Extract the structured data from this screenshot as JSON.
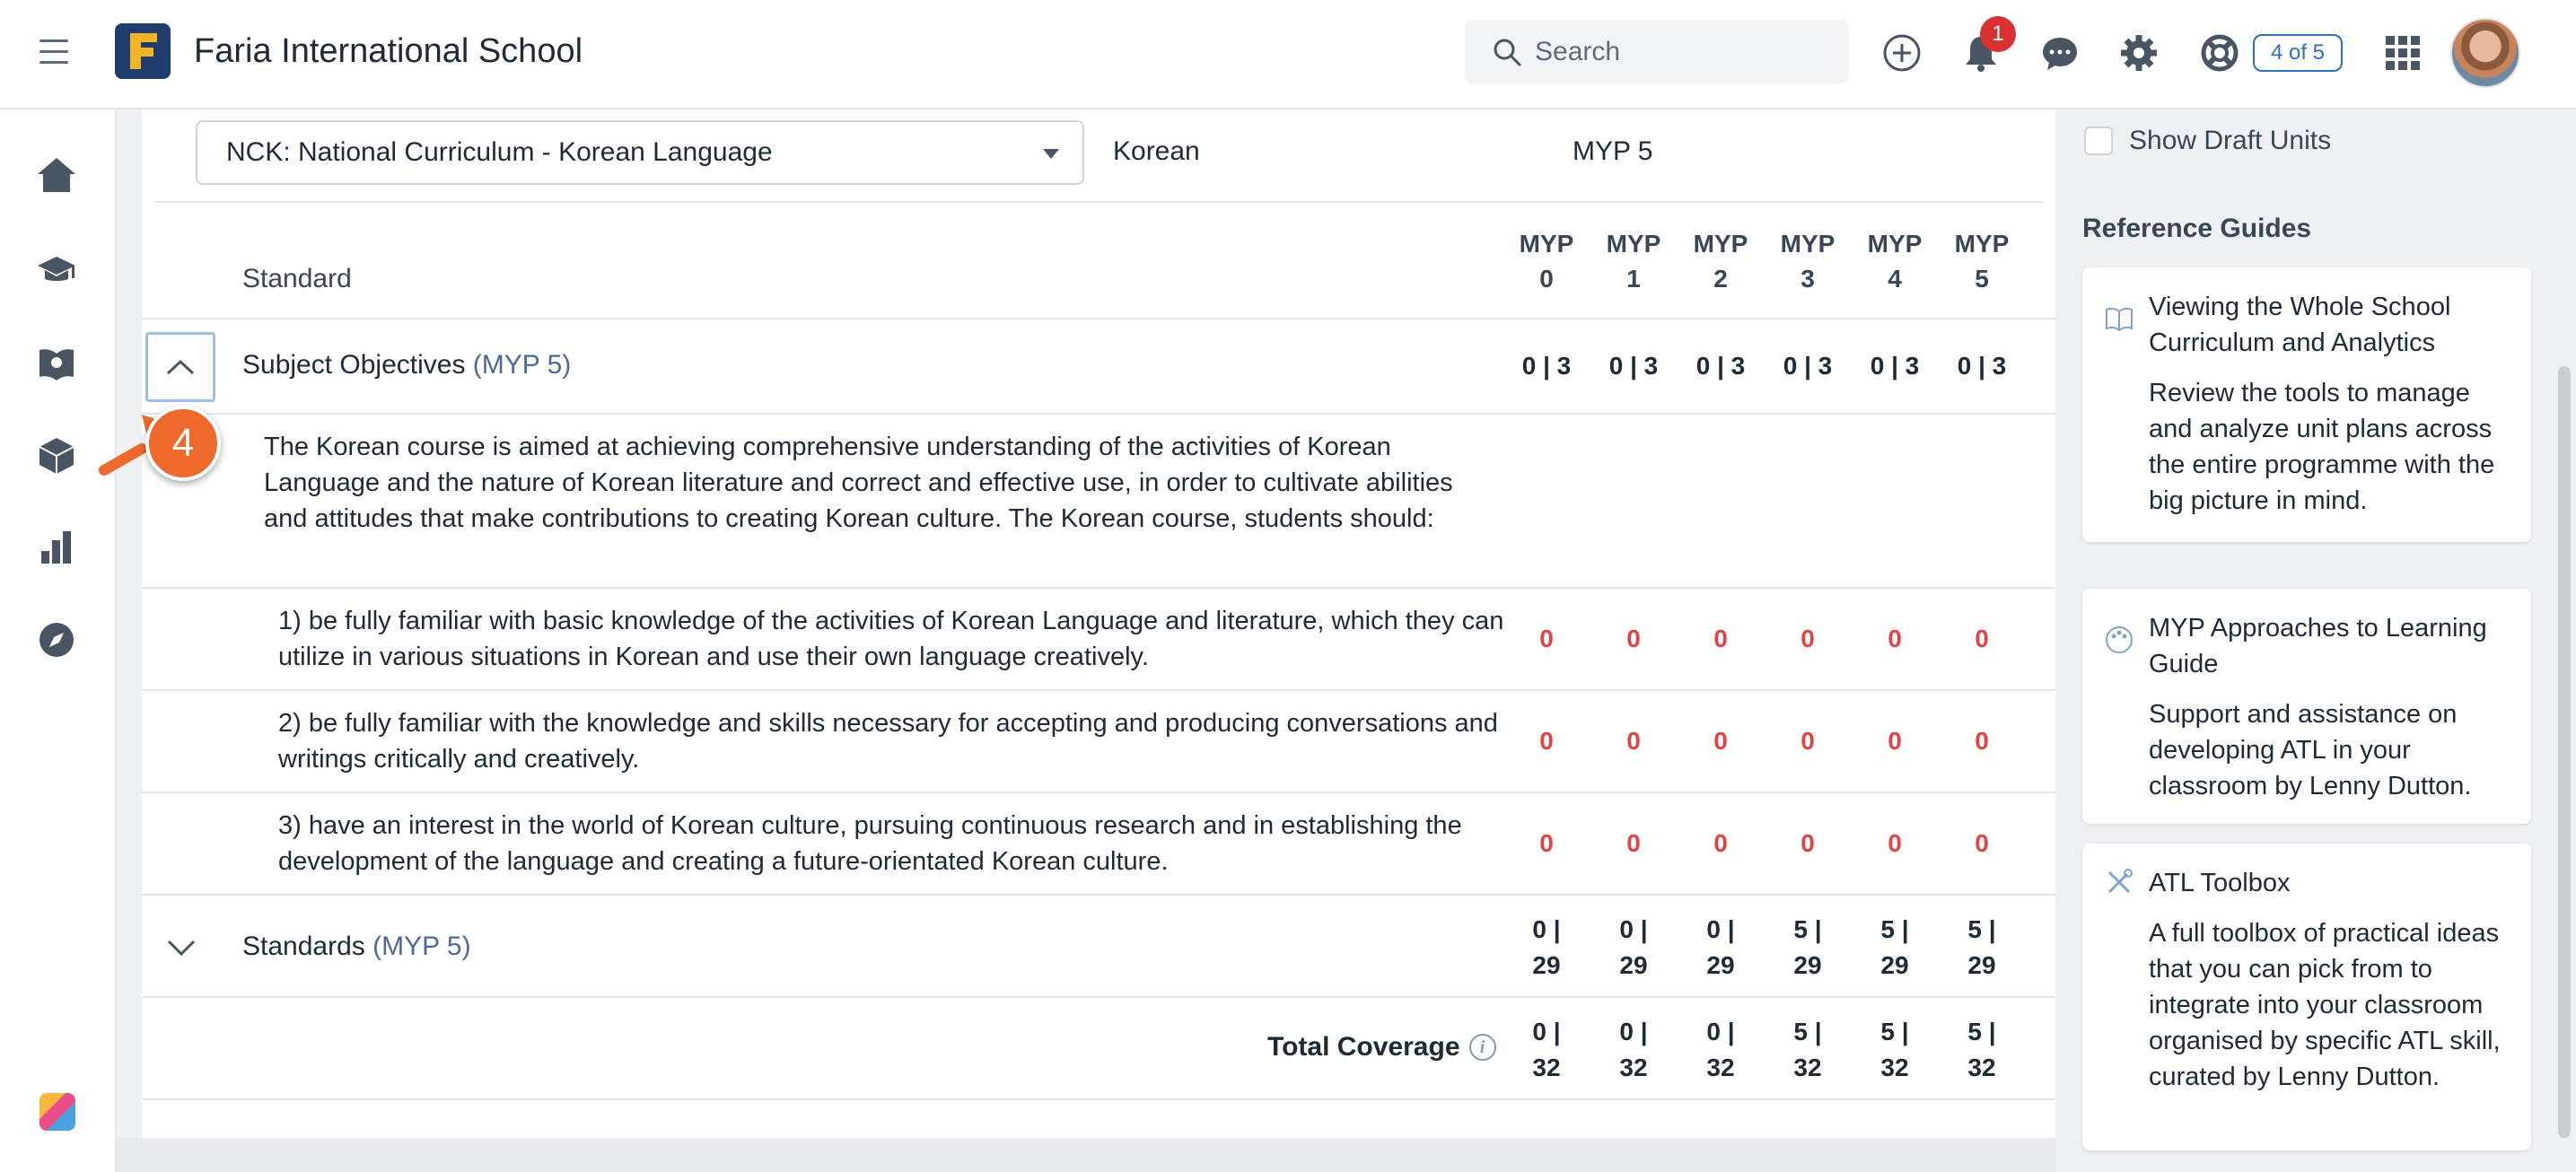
{
  "header": {
    "school_name": "Faria International School",
    "search_placeholder": "Search",
    "notification_count": "1",
    "page_indicator": "4 of 5"
  },
  "filters": {
    "curriculum": "NCK: National Curriculum - Korean Language",
    "subject": "Korean",
    "grade": "MYP 5"
  },
  "table": {
    "standard_header": "Standard",
    "columns": [
      {
        "line1": "MYP",
        "line2": "0"
      },
      {
        "line1": "MYP",
        "line2": "1"
      },
      {
        "line1": "MYP",
        "line2": "2"
      },
      {
        "line1": "MYP",
        "line2": "3"
      },
      {
        "line1": "MYP",
        "line2": "4"
      },
      {
        "line1": "MYP",
        "line2": "5"
      }
    ],
    "subject_objectives": {
      "title": "Subject Objectives",
      "grade": "(MYP 5)",
      "values": [
        "0 | 3",
        "0 | 3",
        "0 | 3",
        "0 | 3",
        "0 | 3",
        "0 | 3"
      ],
      "description": "The Korean course is aimed at achieving comprehensive understanding of the activities of Korean Language and the nature of Korean literature and correct and effective use, in order to cultivate abilities and attitudes that make contributions to creating Korean culture. The Korean course, students should:",
      "objectives": [
        {
          "text": "1) be fully familiar with basic knowledge of the activities of Korean Language and literature, which they can utilize in various situations in Korean and use their own language creatively.",
          "values": [
            "0",
            "0",
            "0",
            "0",
            "0",
            "0"
          ]
        },
        {
          "text": "2) be fully familiar with the knowledge and skills necessary for accepting and producing conversations and writings critically and creatively.",
          "values": [
            "0",
            "0",
            "0",
            "0",
            "0",
            "0"
          ]
        },
        {
          "text": "3) have an interest in the world of Korean culture, pursuing continuous research and in establishing the development of the language and creating a future-orientated Korean culture.",
          "values": [
            "0",
            "0",
            "0",
            "0",
            "0",
            "0"
          ]
        }
      ]
    },
    "standards": {
      "title": "Standards",
      "grade": "(MYP 5)",
      "values": [
        {
          "top": "0 |",
          "bottom": "29"
        },
        {
          "top": "0 |",
          "bottom": "29"
        },
        {
          "top": "0 |",
          "bottom": "29"
        },
        {
          "top": "5 |",
          "bottom": "29"
        },
        {
          "top": "5 |",
          "bottom": "29"
        },
        {
          "top": "5 |",
          "bottom": "29"
        }
      ]
    },
    "total_coverage": {
      "label": "Total Coverage",
      "info_glyph": "i",
      "values": [
        {
          "top": "0",
          "bottom": "32",
          "top_color": "red"
        },
        {
          "top": "0",
          "bottom": "32",
          "top_color": "red"
        },
        {
          "top": "0",
          "bottom": "32",
          "top_color": "red"
        },
        {
          "top": "5",
          "bottom": "32",
          "top_color": "green"
        },
        {
          "top": "5",
          "bottom": "32",
          "top_color": "green"
        },
        {
          "top": "5",
          "bottom": "32",
          "top_color": "green"
        }
      ]
    }
  },
  "step_marker": "4",
  "sidebar_right": {
    "show_draft_label": "Show Draft Units",
    "reference_title": "Reference Guides",
    "guides": [
      {
        "title": "Viewing the Whole School Curriculum and Analytics",
        "description": "Review the tools to manage and analyze unit plans across the entire programme with the big picture in mind.",
        "icon": "book-icon"
      },
      {
        "title": "MYP Approaches to Learning Guide",
        "description": "Support and assistance on developing ATL in your classroom by Lenny Dutton.",
        "icon": "palette-icon"
      },
      {
        "title": "ATL Toolbox",
        "description": "A full toolbox of practical ideas that you can pick from to integrate into your classroom organised by specific ATL skill, curated by Lenny Dutton.",
        "icon": "tools-icon"
      }
    ]
  },
  "colors": {
    "accent": "#2f6fbf",
    "brand_navy": "#1c3d6e",
    "red_value": "#e04545",
    "green_value": "#21b24b",
    "step_orange": "#ee6a2c"
  }
}
